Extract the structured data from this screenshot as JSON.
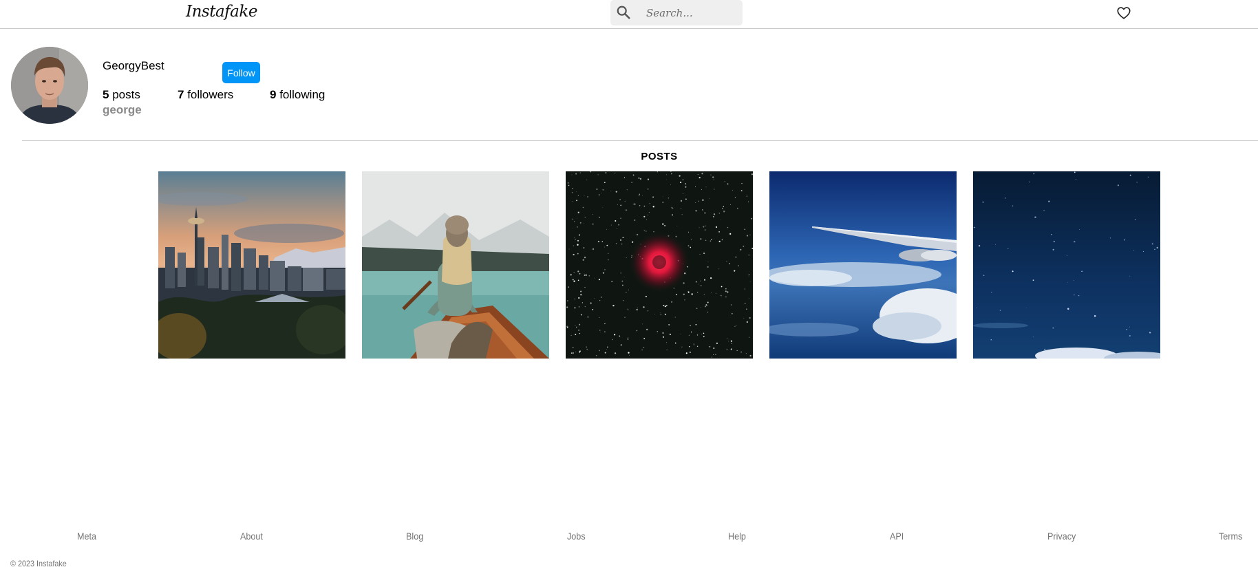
{
  "header": {
    "logo": "Instafake",
    "search_placeholder": "Search...",
    "icons": [
      "search-icon",
      "heart-icon"
    ]
  },
  "profile": {
    "username": "GeorgyBest",
    "follow_label": "Follow",
    "posts_count": "5",
    "posts_label": "posts",
    "followers_count": "7",
    "followers_label": "followers",
    "following_count": "9",
    "following_label": "following",
    "full_name": "george"
  },
  "posts_section": {
    "title": "POSTS",
    "items": [
      {
        "subject": "city-skyline-sunset"
      },
      {
        "subject": "woman-in-canoe-lake"
      },
      {
        "subject": "red-nebula-starfield"
      },
      {
        "subject": "airplane-wing-over-clouds"
      },
      {
        "subject": "night-sky-stars"
      }
    ]
  },
  "footer": {
    "links": [
      "Meta",
      "About",
      "Blog",
      "Jobs",
      "Help",
      "API",
      "Privacy",
      "Terms"
    ],
    "copyright": "© 2023 Instafake"
  },
  "colors": {
    "accent": "#0095f6",
    "muted_text": "#737373",
    "border": "#c9c9c9"
  }
}
